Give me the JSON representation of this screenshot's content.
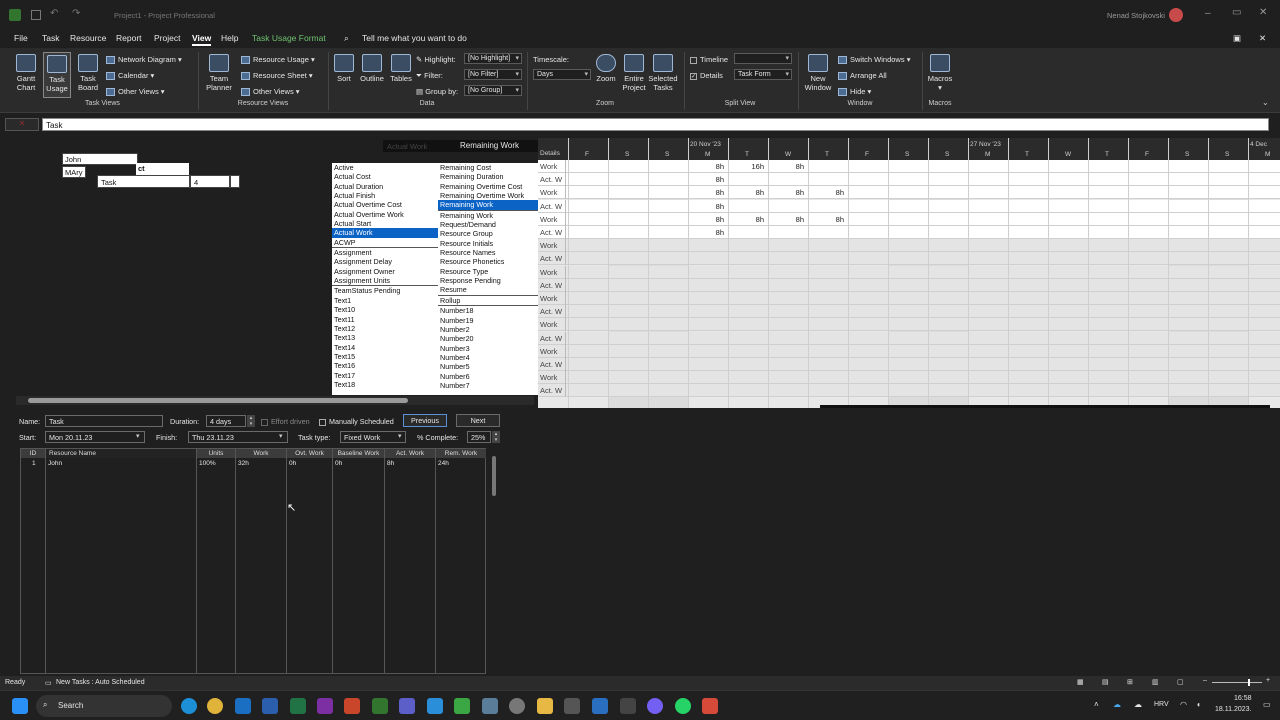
{
  "titlebar": {
    "app": "Project1 - Project Professional",
    "user": "Nenad Stojkovski"
  },
  "menu": [
    "File",
    "Task",
    "Resource",
    "Report",
    "Project",
    "View",
    "Help",
    "Task Usage Format"
  ],
  "tell_me": "Tell me what you want to do",
  "ribbon": {
    "task_views": {
      "gantt": "Gantt\nChart",
      "usage": "Task\nUsage",
      "board": "Task\nBoard",
      "network": "Network Diagram",
      "calendar": "Calendar",
      "other": "Other Views",
      "label": "Task Views"
    },
    "resource_views": {
      "planner": "Team\nPlanner",
      "usage": "Resource Usage",
      "sheet": "Resource Sheet",
      "other": "Other Views",
      "label": "Resource Views"
    },
    "data": {
      "sort": "Sort",
      "outline": "Outline",
      "tables": "Tables",
      "highlight": "Highlight:",
      "highlight_val": "[No Highlight]",
      "filter": "Filter:",
      "filter_val": "[No Filter]",
      "group": "Group by:",
      "group_val": "[No Group]",
      "label": "Data"
    },
    "zoom": {
      "timescale": "Timescale:",
      "timescale_val": "Days",
      "zoom": "Zoom",
      "entire": "Entire\nProject",
      "selected": "Selected\nTasks",
      "label": "Zoom"
    },
    "split": {
      "timeline": "Timeline",
      "details": "Details",
      "details_val": "Task Form",
      "label": "Split View"
    },
    "window": {
      "new": "New\nWindow",
      "switch": "Switch Windows",
      "arrange": "Arrange All",
      "hide": "Hide",
      "label": "Window"
    },
    "macros": {
      "macros": "Macros",
      "label": "Macros"
    }
  },
  "formula_value": "Task",
  "view": {
    "names": [
      "John",
      "MAry"
    ],
    "project_partial": "ct",
    "task_row": {
      "name": "Task",
      "value": "4"
    },
    "header_left": "Actual Work",
    "header_right": "Remaining Work",
    "details_label": "Details",
    "week1": "20 Nov '23",
    "week2": "27 Nov '23",
    "week3": "4 Dec",
    "days": [
      "F",
      "S",
      "S",
      "M",
      "T",
      "W",
      "T",
      "F",
      "S",
      "S",
      "M",
      "T",
      "W",
      "T",
      "F",
      "S",
      "S",
      "M"
    ],
    "detail_rows": [
      {
        "label": "Work",
        "cells": [
          "",
          "",
          "",
          "8h",
          "16h",
          "8h",
          "",
          "",
          "",
          "",
          "",
          "",
          "",
          "",
          "",
          "",
          "",
          ""
        ]
      },
      {
        "label": "Act. W",
        "cells": [
          "",
          "",
          "",
          "8h",
          "",
          "",
          "",
          "",
          "",
          "",
          "",
          "",
          "",
          "",
          "",
          "",
          "",
          ""
        ]
      },
      {
        "label": "Work",
        "cells": [
          "",
          "",
          "",
          "8h",
          "8h",
          "8h",
          "8h",
          "",
          "",
          "",
          "",
          "",
          "",
          "",
          "",
          "",
          "",
          ""
        ]
      },
      {
        "label": "Act. W",
        "cells": [
          "",
          "",
          "",
          "8h",
          "",
          "",
          "",
          "",
          "",
          "",
          "",
          "",
          "",
          "",
          "",
          "",
          "",
          ""
        ]
      },
      {
        "label": "Work",
        "cells": [
          "",
          "",
          "",
          "8h",
          "8h",
          "8h",
          "8h",
          "",
          "",
          "",
          "",
          "",
          "",
          "",
          "",
          "",
          "",
          ""
        ]
      },
      {
        "label": "Act. W",
        "cells": [
          "",
          "",
          "",
          "8h",
          "",
          "",
          "",
          "",
          "",
          "",
          "",
          "",
          "",
          "",
          "",
          "",
          "",
          ""
        ]
      },
      {
        "label": "Work",
        "cells": []
      },
      {
        "label": "Act. W",
        "cells": []
      },
      {
        "label": "Work",
        "cells": []
      },
      {
        "label": "Act. W",
        "cells": []
      },
      {
        "label": "Work",
        "cells": []
      },
      {
        "label": "Act. W",
        "cells": []
      },
      {
        "label": "Work",
        "cells": []
      },
      {
        "label": "Act. W",
        "cells": []
      },
      {
        "label": "Work",
        "cells": []
      },
      {
        "label": "Act. W",
        "cells": []
      },
      {
        "label": "Work",
        "cells": []
      },
      {
        "label": "Act. W",
        "cells": []
      }
    ],
    "field_list_left": [
      "Active",
      "Actual Cost",
      "Actual Duration",
      "Actual Finish",
      "Actual Overtime Cost",
      "Actual Overtime Work",
      "Actual Start",
      "Actual Work",
      "ACWP",
      "Assignment",
      "Assignment Delay",
      "Assignment Owner",
      "Assignment Units",
      "",
      "TeamStatus Pending",
      "Text1",
      "Text10",
      "Text11",
      "Text12",
      "Text13",
      "Text14",
      "Text15",
      "Text16",
      "Text17",
      "Text18"
    ],
    "field_list_right": [
      "Remaining Cost",
      "Remaining Duration",
      "Remaining Overtime Cost",
      "Remaining Overtime Work",
      "Remaining Work",
      "",
      "Remaining Work",
      "Request/Demand",
      "Resource Group",
      "Resource Initials",
      "Resource Names",
      "Resource Phonetics",
      "Resource Type",
      "Response Pending",
      "Resume",
      "Rollup",
      "Number18",
      "Number19",
      "Number2",
      "Number20",
      "Number3",
      "Number4",
      "Number5",
      "Number6",
      "Number7"
    ]
  },
  "form": {
    "name_label": "Name:",
    "name_val": "Task",
    "duration_label": "Duration:",
    "duration_val": "4 days",
    "effort": "Effort driven",
    "manual": "Manually Scheduled",
    "previous": "Previous",
    "next": "Next",
    "start_label": "Start:",
    "start_val": "Mon 20.11.23",
    "finish_label": "Finish:",
    "finish_val": "Thu 23.11.23",
    "tasktype_label": "Task type:",
    "tasktype_val": "Fixed Work",
    "pct_label": "% Complete:",
    "pct_val": "25%",
    "columns": [
      "ID",
      "Resource Name",
      "Units",
      "Work",
      "Ovt. Work",
      "Baseline Work",
      "Act. Work",
      "Rem. Work"
    ],
    "row": [
      "1",
      "John",
      "100%",
      "32h",
      "0h",
      "0h",
      "8h",
      "24h"
    ]
  },
  "status": {
    "ready": "Ready",
    "new_tasks": "New Tasks : Auto Scheduled"
  },
  "taskbar": {
    "search": "Search",
    "lang": "HRV",
    "time": "16:58",
    "date": "18.11.2023."
  }
}
